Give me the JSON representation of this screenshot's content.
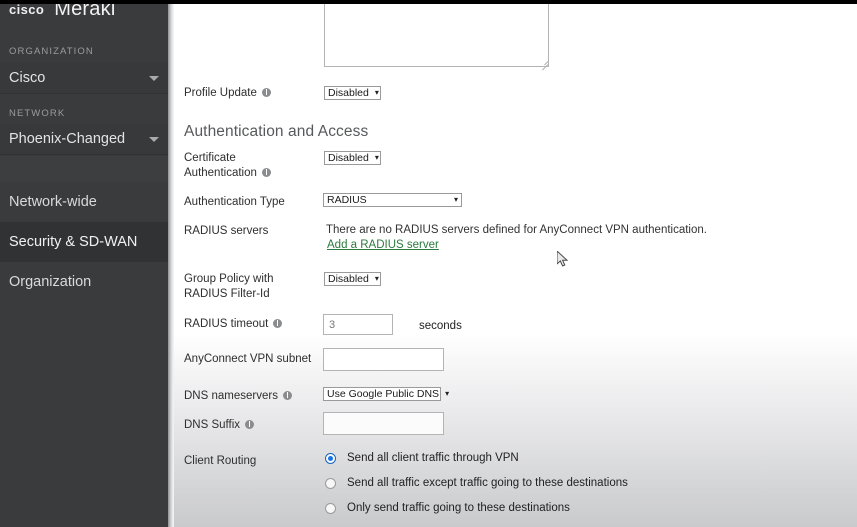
{
  "sidebar": {
    "logo": {
      "cisco": "cisco",
      "meraki": "Meraki"
    },
    "organization_label": "ORGANIZATION",
    "organization_value": "Cisco",
    "network_label": "NETWORK",
    "network_value": "Phoenix-Changed",
    "nav": [
      {
        "label": "Network-wide",
        "selected": false
      },
      {
        "label": "Security & SD-WAN",
        "selected": true
      },
      {
        "label": "Organization",
        "selected": false
      }
    ]
  },
  "form": {
    "profile_update": {
      "label": "Profile Update",
      "value": "Disabled"
    },
    "section_heading": "Authentication and Access",
    "certificate_authentication": {
      "label_line1": "Certificate",
      "label_line2": "Authentication",
      "value": "Disabled"
    },
    "authentication_type": {
      "label": "Authentication Type",
      "value": "RADIUS"
    },
    "radius_servers": {
      "label": "RADIUS servers",
      "empty_text": "There are no RADIUS servers defined for AnyConnect VPN authentication.",
      "add_link": "Add a RADIUS server"
    },
    "group_policy": {
      "label_line1": "Group Policy with",
      "label_line2": "RADIUS Filter-Id",
      "value": "Disabled"
    },
    "radius_timeout": {
      "label": "RADIUS timeout",
      "value": "3",
      "unit": "seconds"
    },
    "anyconnect_subnet": {
      "label": "AnyConnect VPN subnet",
      "value": ""
    },
    "dns_nameservers": {
      "label": "DNS nameservers",
      "value": "Use Google Public DNS"
    },
    "dns_suffix": {
      "label": "DNS Suffix",
      "value": ""
    },
    "client_routing": {
      "label": "Client Routing",
      "options": [
        {
          "label": "Send all client traffic through VPN",
          "selected": true
        },
        {
          "label": "Send all traffic except traffic going to these destinations",
          "selected": false
        },
        {
          "label": "Only send traffic going to these destinations",
          "selected": false
        }
      ]
    }
  },
  "colors": {
    "sidebar_bg": "#3a3b3d",
    "sidebar_selected": "#313234",
    "link_green": "#2c7a3f",
    "radio_accent": "#1a73e8",
    "heading_gray": "#58595b"
  },
  "icons": {
    "info": "info-icon",
    "chevron_down": "chevron-down-icon",
    "cursor": "mouse-cursor"
  }
}
